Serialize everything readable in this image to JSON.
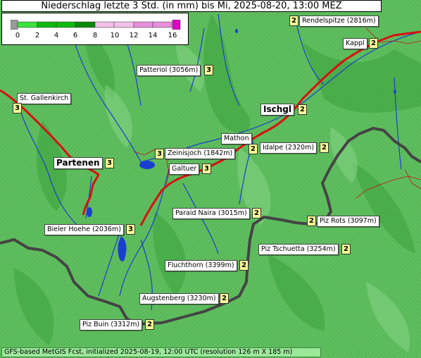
{
  "title": "Niederschlag letzte 3 Std. (in mm) bis Mi, 2025-08-20, 13:00 MEZ",
  "legend": {
    "ticks": [
      "0",
      "2",
      "4",
      "6",
      "8",
      "10",
      "12",
      "14",
      "16"
    ],
    "colors": {
      "below": "#9a9a9a",
      "band1": "#3ee03e",
      "band2": "#11b811",
      "band3": "#0a8a0a",
      "band4": "#f4c0ea",
      "band5": "#e890dc",
      "above": "#e000c8"
    }
  },
  "places": [
    {
      "name": "Rendelspitze (2816m)",
      "value": "2"
    },
    {
      "name": "Kappl",
      "value": "2"
    },
    {
      "name": "Patteriol (3056m)",
      "value": "3"
    },
    {
      "name": "St. Gallenkirch",
      "value": "3"
    },
    {
      "name": "Ischgl",
      "value": "2"
    },
    {
      "name": "Mathon",
      "value": "2"
    },
    {
      "name": "Idalpe (2320m)",
      "value": "2"
    },
    {
      "name": "Zeinisjoch (1842m)",
      "value": "3"
    },
    {
      "name": "Partenen",
      "value": "3"
    },
    {
      "name": "Galtuer",
      "value": "3"
    },
    {
      "name": "Paraid Naira (3015m)",
      "value": "2"
    },
    {
      "name": "Piz Rots (3097m)",
      "value": "2"
    },
    {
      "name": "Bieler Hoehe (2036m)",
      "value": "3"
    },
    {
      "name": "Piz Tschuetta (3254m)",
      "value": "2"
    },
    {
      "name": "Fluchthorn (3399m)",
      "value": "2"
    },
    {
      "name": "Augstenberg (3230m)",
      "value": "2"
    },
    {
      "name": "Piz Buin (3312m)",
      "value": "2"
    }
  ],
  "footer": "GFS-based MetGIS Fcst, initialized 2025-08-19, 12:00 UTC  (resolution 126 m X 185 m)",
  "colors": {
    "terrain": "#5fbf5f",
    "river": "#1a3fd0",
    "road": "#d81010",
    "border": "#444444"
  }
}
